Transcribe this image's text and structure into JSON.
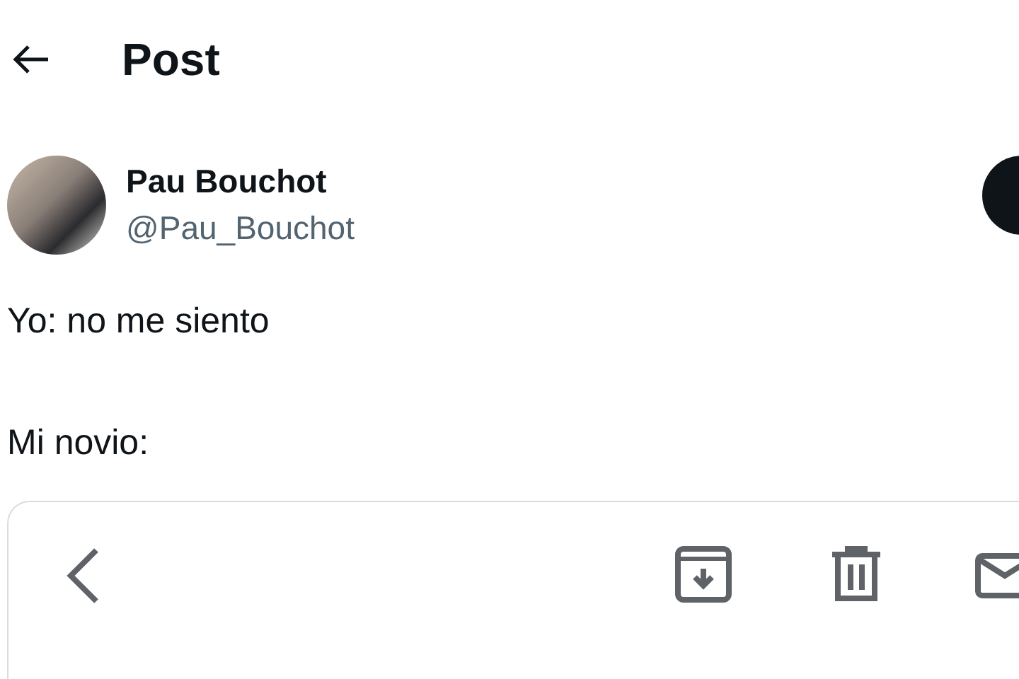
{
  "header": {
    "title": "Post"
  },
  "author": {
    "name": "Pau Bouchot",
    "handle": "@Pau_Bouchot"
  },
  "post": {
    "lines": [
      "Yo: no me siento",
      "Mi novio:"
    ]
  }
}
